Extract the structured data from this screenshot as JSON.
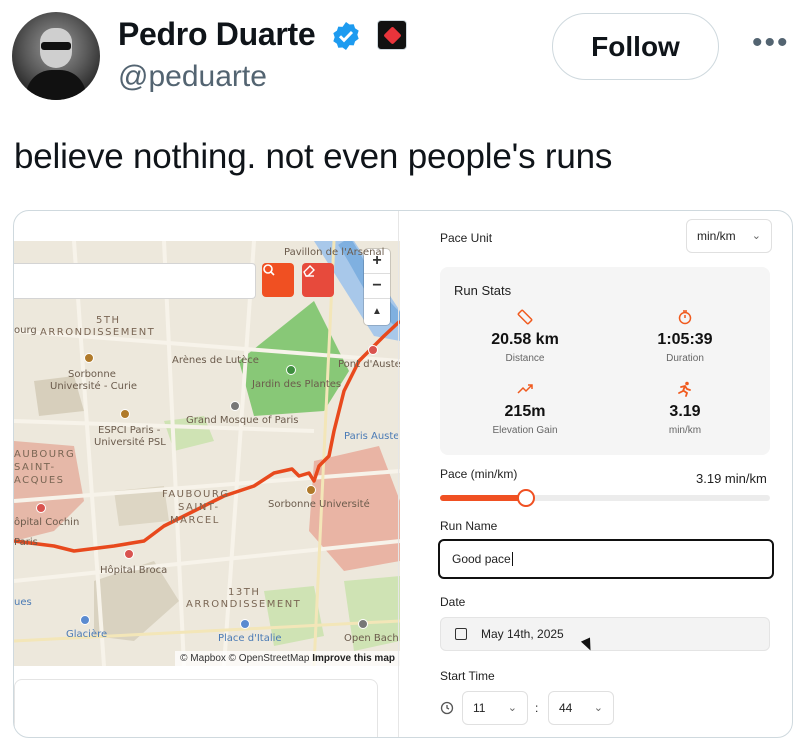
{
  "tweet": {
    "name": "Pedro Duarte",
    "handle": "@peduarte",
    "follow_label": "Follow",
    "more_label": "•••",
    "text": "believe nothing. not even people's runs"
  },
  "map": {
    "labels": {
      "l5th": "5TH",
      "arrondissement_1": "ARRONDISSEMENT",
      "pavillon": "Pavillon de l'Arsenal",
      "arenes": "Arènes de Lutèce",
      "jardin": "Jardin des Plantes",
      "pont": "Pont d'Austerlitz",
      "sorbonne_curie_1": "Sorbonne",
      "sorbonne_curie_2": "Université - Curie",
      "espci_1": "ESPCI Paris -",
      "espci_2": "Université PSL",
      "mosque": "Grand Mosque of Paris",
      "paris_auster": "Paris Austerlitz",
      "faubourg_left_1": "AUBOURG",
      "faubourg_left_2": "SAINT-",
      "faubourg_left_3": "ACQUES",
      "faubourg_mid_1": "FAUBOURG",
      "faubourg_mid_2": "SAINT-",
      "faubourg_mid_3": "MARCEL",
      "sorbonne_u": "Sorbonne Université",
      "hopital_cochin": "ôpital Cochin",
      "paris": "Paris",
      "hopital_broca": "Hôpital Broca",
      "l13th": "13TH",
      "arrondissement_2": "ARRONDISSEMENT",
      "glaciere": "Glacière",
      "place_italie": "Place d'Italie",
      "open_bach": "Open Bach",
      "ques": "ues",
      "ourg": "ourg"
    },
    "zoom_in": "+",
    "zoom_out": "−",
    "compass": "▲",
    "attribution_1": "© Mapbox © OpenStreetMap",
    "attribution_2": "Improve this map"
  },
  "panel": {
    "pace_unit_label": "Pace Unit",
    "pace_unit_value": "min/km",
    "run_stats_title": "Run Stats",
    "stats": {
      "distance_value": "20.58 km",
      "distance_label": "Distance",
      "duration_value": "1:05:39",
      "duration_label": "Duration",
      "elevation_value": "215m",
      "elevation_label": "Elevation Gain",
      "pace_value": "3.19",
      "pace_label": "min/km"
    },
    "pace_slider_label": "Pace (min/km)",
    "pace_slider_value": "3.19 min/km",
    "pace_slider_fraction": 0.26,
    "run_name_label": "Run Name",
    "run_name_value": "Good pace",
    "date_label": "Date",
    "date_value": "May 14th, 2025",
    "start_time_label": "Start Time",
    "hour_value": "11",
    "minute_value": "44",
    "time_separator": ":"
  },
  "colors": {
    "accent": "#f05022",
    "verified": "#1d9bf0",
    "route": "#e8491d"
  },
  "icons": {
    "verified": "verified-badge-icon",
    "affiliate": "affiliate-badge-icon",
    "search": "search-icon",
    "eraser": "eraser-icon",
    "ruler": "ruler-icon",
    "stopwatch": "stopwatch-icon",
    "trend": "trend-up-icon",
    "runner": "runner-icon",
    "calendar": "calendar-icon",
    "clock": "clock-icon",
    "chevron": "chevron-down-icon"
  }
}
